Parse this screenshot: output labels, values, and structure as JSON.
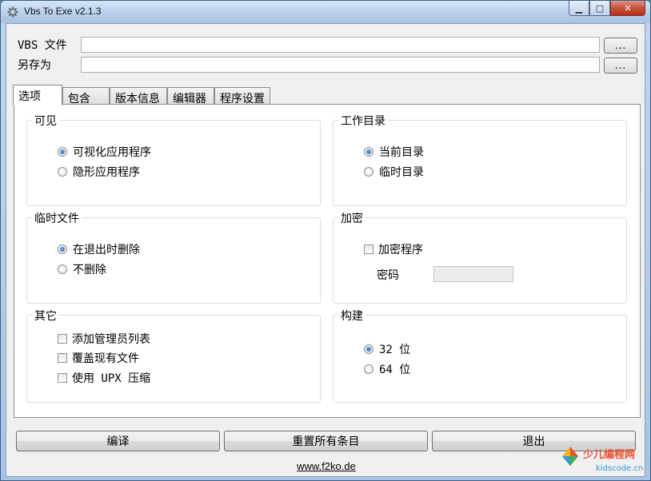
{
  "window": {
    "title": "Vbs To Exe v2.1.3",
    "app_icon": "gear-icon",
    "controls": {
      "minimize_glyph": "▁",
      "maximize_glyph": "□",
      "close_glyph": "✕"
    }
  },
  "files": {
    "vbs_label": "VBS 文件",
    "vbs_value": "",
    "save_label": "另存为",
    "save_value": "",
    "browse_label": "..."
  },
  "tabs": [
    {
      "label": "选项",
      "active": true
    },
    {
      "label": "包含",
      "active": false
    },
    {
      "label": "版本信息",
      "active": false
    },
    {
      "label": "编辑器",
      "active": false
    },
    {
      "label": "程序设置",
      "active": false
    }
  ],
  "groups": {
    "visible": {
      "title": "可见",
      "options": [
        {
          "label": "可视化应用程序",
          "selected": true
        },
        {
          "label": "隐形应用程序",
          "selected": false
        }
      ]
    },
    "workdir": {
      "title": "工作目录",
      "options": [
        {
          "label": "当前目录",
          "selected": true
        },
        {
          "label": "临时目录",
          "selected": false
        }
      ]
    },
    "tempfiles": {
      "title": "临时文件",
      "options": [
        {
          "label": "在退出时删除",
          "selected": true
        },
        {
          "label": "不删除",
          "selected": false
        }
      ]
    },
    "encrypt": {
      "title": "加密",
      "checkbox_label": "加密程序",
      "checked": false,
      "password_label": "密码",
      "password_value": ""
    },
    "other": {
      "title": "其它",
      "checkboxes": [
        {
          "label": "添加管理员列表",
          "checked": false
        },
        {
          "label": "覆盖现有文件",
          "checked": false
        },
        {
          "label": "使用 UPX 压缩",
          "checked": false
        }
      ]
    },
    "build": {
      "title": "构建",
      "options": [
        {
          "label": "32 位",
          "selected": true
        },
        {
          "label": "64 位",
          "selected": false
        }
      ]
    }
  },
  "actions": {
    "compile": "编译",
    "reset": "重置所有条目",
    "exit": "退出"
  },
  "footer": {
    "link": "www.f2ko.de"
  },
  "watermark": {
    "brand": "少儿编程网",
    "domain": "kidscode.cn"
  },
  "colors": {
    "accent_radio": "#1f5fa8",
    "title_close": "#c9533f"
  }
}
